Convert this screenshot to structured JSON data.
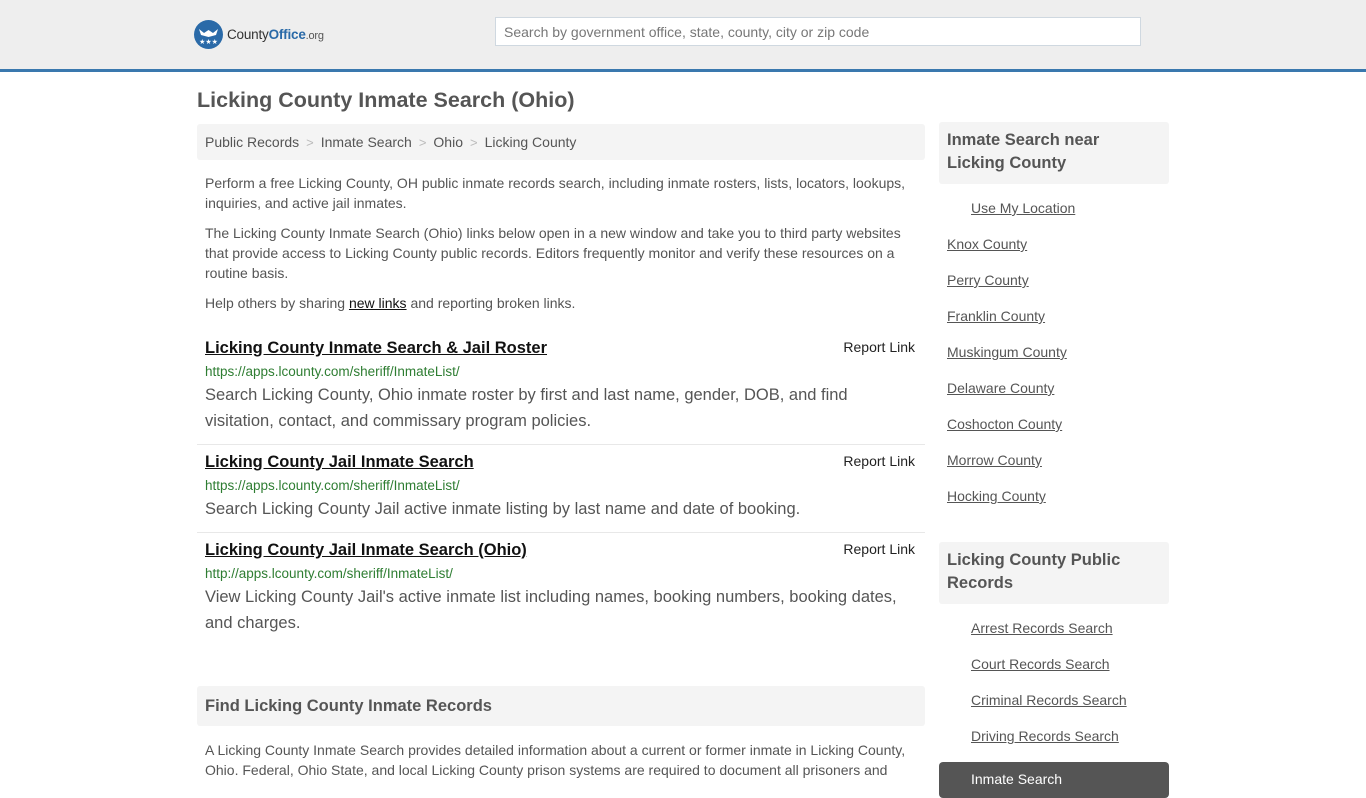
{
  "header": {
    "logo": {
      "name": "County",
      "office": "Office",
      "tld": ".org"
    },
    "search_placeholder": "Search by government office, state, county, city or zip code",
    "accent_color": "#3a78ae"
  },
  "page_title": "Licking County Inmate Search (Ohio)",
  "breadcrumb": [
    {
      "label": "Public Records"
    },
    {
      "label": "Inmate Search"
    },
    {
      "label": "Ohio"
    },
    {
      "label": "Licking County"
    }
  ],
  "breadcrumb_separator": ">",
  "intro": {
    "p1": "Perform a free Licking County, OH public inmate records search, including inmate rosters, lists, locators, lookups, inquiries, and active jail inmates.",
    "p2": "The Licking County Inmate Search (Ohio) links below open in a new window and take you to third party websites that provide access to Licking County public records. Editors frequently monitor and verify these resources on a routine basis.",
    "p3_before": "Help others by sharing ",
    "p3_link": "new links",
    "p3_after": " and reporting broken links."
  },
  "links": [
    {
      "title": "Licking County Inmate Search & Jail Roster",
      "report": "Report Link",
      "url": "https://apps.lcounty.com/sheriff/InmateList/",
      "description": "Search Licking County, Ohio inmate roster by first and last name, gender, DOB, and find visitation, contact, and commissary program policies."
    },
    {
      "title": "Licking County Jail Inmate Search",
      "report": "Report Link",
      "url": "https://apps.lcounty.com/sheriff/InmateList/",
      "description": "Search Licking County Jail active inmate listing by last name and date of booking."
    },
    {
      "title": "Licking County Jail Inmate Search (Ohio)",
      "report": "Report Link",
      "url": "http://apps.lcounty.com/sheriff/InmateList/",
      "description": "View Licking County Jail's active inmate list including names, booking numbers, booking dates, and charges."
    }
  ],
  "find_section": {
    "heading": "Find Licking County Inmate Records",
    "body": "A Licking County Inmate Search provides detailed information about a current or former inmate in Licking County, Ohio. Federal, Ohio State, and local Licking County prison systems are required to document all prisoners and"
  },
  "sidebar": {
    "nearby": {
      "heading": "Inmate Search near Licking County",
      "use_location": "Use My Location",
      "items": [
        "Knox County",
        "Perry County",
        "Franklin County",
        "Muskingum County",
        "Delaware County",
        "Coshocton County",
        "Morrow County",
        "Hocking County"
      ]
    },
    "public_records": {
      "heading": "Licking County Public Records",
      "items": [
        "Arrest Records Search",
        "Court Records Search",
        "Criminal Records Search",
        "Driving Records Search"
      ],
      "active": "Inmate Search"
    }
  }
}
